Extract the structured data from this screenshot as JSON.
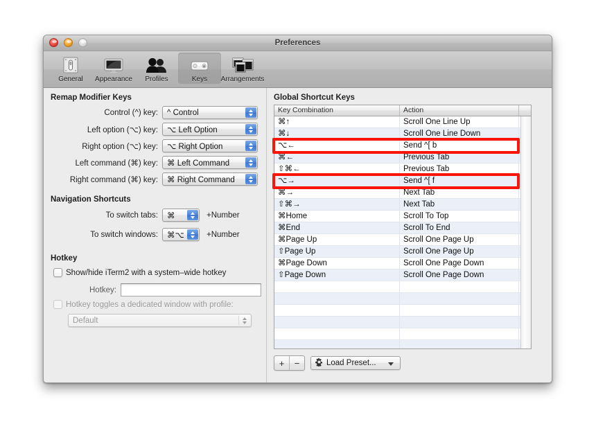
{
  "window": {
    "title": "Preferences",
    "traffic": {
      "close": "close-button",
      "minimize": "minimize-button",
      "zoom": "zoom-button"
    }
  },
  "toolbar": {
    "items": [
      {
        "label": "General",
        "icon": "general-icon",
        "selected": false
      },
      {
        "label": "Appearance",
        "icon": "appearance-icon",
        "selected": false
      },
      {
        "label": "Profiles",
        "icon": "profiles-icon",
        "selected": false
      },
      {
        "label": "Keys",
        "icon": "keys-icon",
        "selected": true
      },
      {
        "label": "Arrangements",
        "icon": "arrangements-icon",
        "selected": false
      }
    ]
  },
  "remap": {
    "title": "Remap Modifier Keys",
    "rows": [
      {
        "label": "Control (^) key:",
        "value": "^ Control"
      },
      {
        "label": "Left option (⌥) key:",
        "value": "⌥ Left Option"
      },
      {
        "label": "Right option (⌥) key:",
        "value": "⌥ Right Option"
      },
      {
        "label": "Left command (⌘) key:",
        "value": "⌘ Left Command"
      },
      {
        "label": "Right command (⌘) key:",
        "value": "⌘ Right Command"
      }
    ]
  },
  "navigation": {
    "title": "Navigation Shortcuts",
    "rows": [
      {
        "label": "To switch tabs:",
        "value": "⌘",
        "suffix": "+Number"
      },
      {
        "label": "To switch windows:",
        "value": "⌘⌥",
        "suffix": "+Number"
      }
    ]
  },
  "hotkey": {
    "title": "Hotkey",
    "checkbox_label": "Show/hide iTerm2 with a system–wide hotkey",
    "checkbox_checked": false,
    "field_label": "Hotkey:",
    "field_value": "",
    "dedicated_label": "Hotkey toggles a dedicated window with profile:",
    "dedicated_checked": false,
    "dedicated_disabled": true,
    "profile_value": "Default",
    "profile_disabled": true
  },
  "shortcuts": {
    "title": "Global Shortcut Keys",
    "columns": [
      "Key Combination",
      "Action",
      ""
    ],
    "rows": [
      {
        "key": "⌘↑",
        "action": "Scroll One Line Up"
      },
      {
        "key": "⌘↓",
        "action": "Scroll One Line Down"
      },
      {
        "key": "⌥←",
        "action": "Send ^[ b"
      },
      {
        "key": "⌘←",
        "action": "Previous Tab"
      },
      {
        "key": "⇧⌘←",
        "action": "Previous Tab"
      },
      {
        "key": "⌥→",
        "action": "Send ^[ f"
      },
      {
        "key": "⌘→",
        "action": "Next Tab"
      },
      {
        "key": "⇧⌘→",
        "action": "Next Tab"
      },
      {
        "key": "⌘Home",
        "action": "Scroll To Top"
      },
      {
        "key": "⌘End",
        "action": "Scroll To End"
      },
      {
        "key": "⌘Page Up",
        "action": "Scroll One Page Up"
      },
      {
        "key": "⇧Page Up",
        "action": "Scroll One Page Up"
      },
      {
        "key": "⌘Page Down",
        "action": "Scroll One Page Down"
      },
      {
        "key": "⇧Page Down",
        "action": "Scroll One Page Down"
      },
      {
        "key": "",
        "action": ""
      },
      {
        "key": "",
        "action": ""
      },
      {
        "key": "",
        "action": ""
      },
      {
        "key": "",
        "action": ""
      },
      {
        "key": "",
        "action": ""
      },
      {
        "key": "",
        "action": ""
      }
    ],
    "highlighted_rows": [
      2,
      5
    ],
    "highlight_color": "#fb1409"
  },
  "bottom": {
    "add_label": "+",
    "remove_label": "−",
    "preset_label": "Load Preset...",
    "preset_icon": "gear-icon"
  }
}
